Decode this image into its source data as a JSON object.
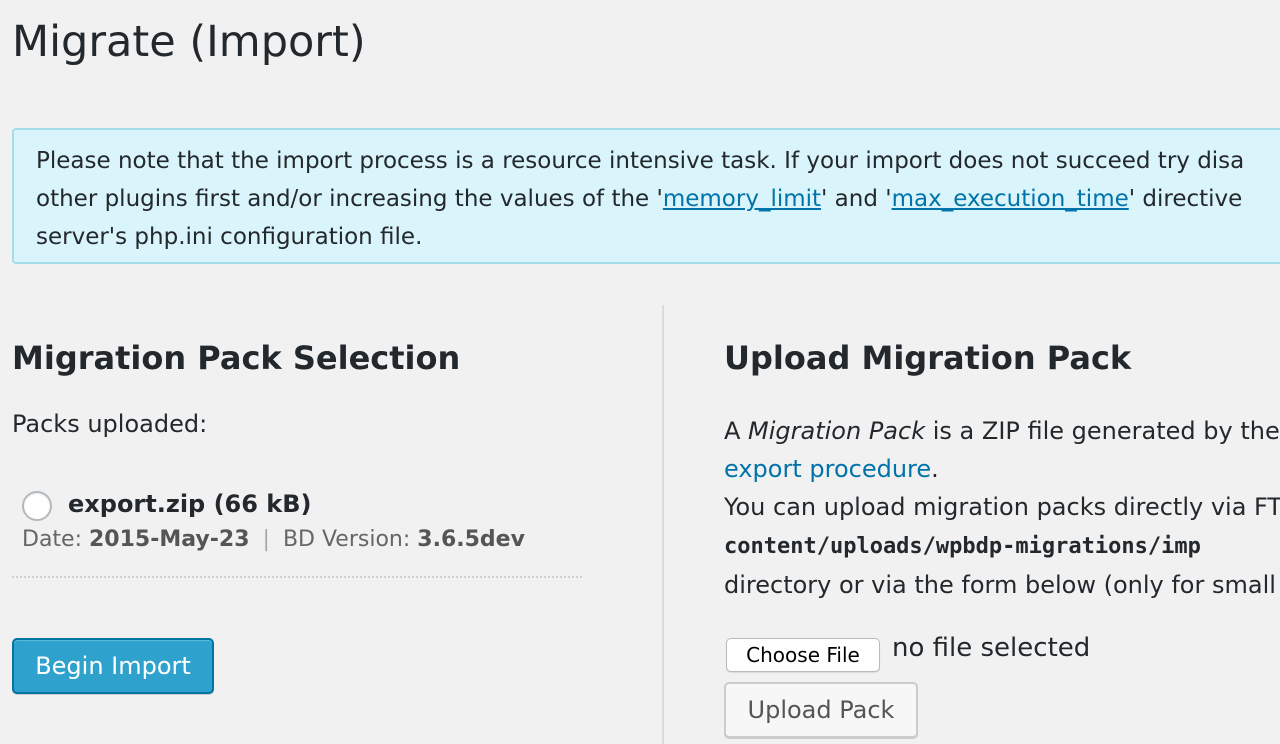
{
  "page": {
    "title": "Migrate (Import)"
  },
  "notice": {
    "text_before": "Please note that the import process is a resource intensive task. If your import does not succeed try disa",
    "text_line2_start": "other plugins first and/or increasing the values of the '",
    "memory_link": "memory_limit",
    "text_and": "' and '",
    "exec_link": "max_execution_time",
    "text_after": "' directive",
    "text_line3": "server's php.ini configuration file."
  },
  "selection": {
    "title": "Migration Pack Selection",
    "packs_label": "Packs uploaded:",
    "pack": {
      "name": "export.zip (66 kB)",
      "date_label": "Date:",
      "date": "2015-May-23",
      "separator": "|",
      "version_label": "BD Version:",
      "version": "3.6.5dev"
    },
    "begin_button": "Begin Import"
  },
  "upload": {
    "title": "Upload Migration Pack",
    "desc_a": "A ",
    "desc_em": "Migration Pack",
    "desc_rest": " is a ZIP file generated by the r",
    "export_link": "export procedure",
    "desc_period": ".",
    "ftp_line": "You can upload migration packs directly via FT",
    "path": "content/uploads/wpbdp-migrations/imp",
    "directory_line": "directory or via the form below (only for small",
    "choose_file": "Choose File",
    "file_status": "no file selected",
    "upload_button": "Upload Pack"
  }
}
